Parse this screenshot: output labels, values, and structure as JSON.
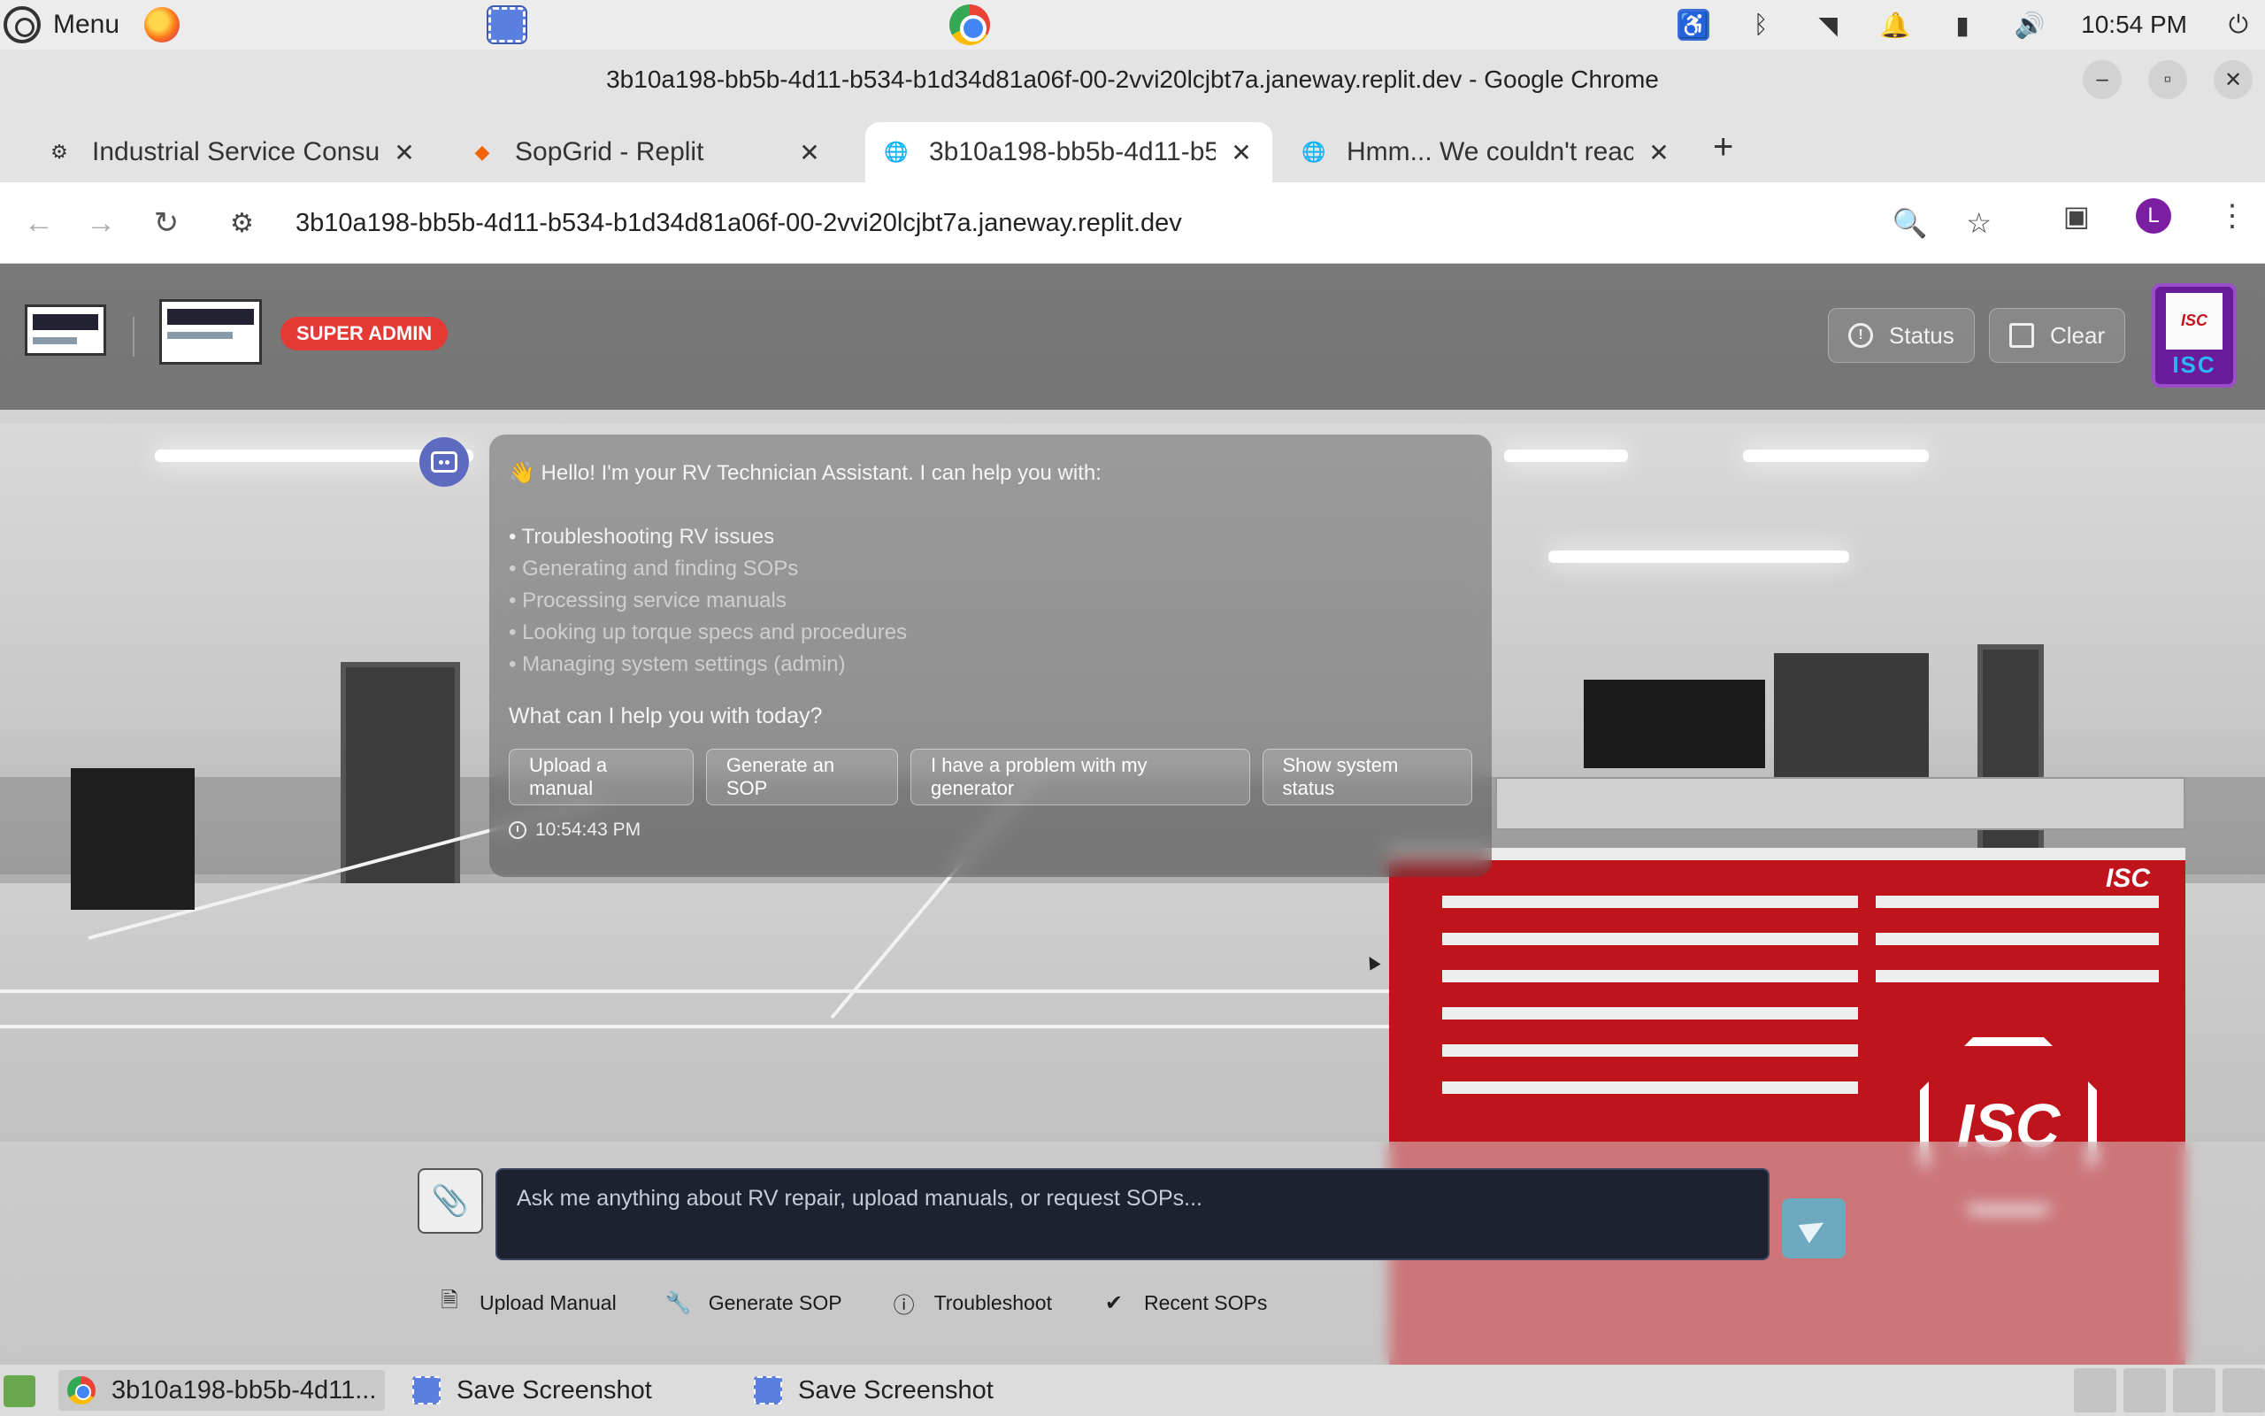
{
  "os": {
    "menu_label": "Menu",
    "clock": "10:54 PM"
  },
  "window": {
    "title": "3b10a198-bb5b-4d11-b534-b1d34d81a06f-00-2vvi20lcjbt7a.janeway.replit.dev - Google Chrome"
  },
  "tabs": [
    {
      "label": "Industrial Service Consul",
      "icon": "openai-icon"
    },
    {
      "label": "SopGrid - Replit",
      "icon": "replit-icon"
    },
    {
      "label": "3b10a198-bb5b-4d11-b5",
      "icon": "globe-icon"
    },
    {
      "label": "Hmm... We couldn't reac",
      "icon": "globe-icon"
    }
  ],
  "address_bar": {
    "url": "3b10a198-bb5b-4d11-b534-b1d34d81a06f-00-2vvi20lcjbt7a.janeway.replit.dev",
    "profile_initial": "L"
  },
  "app": {
    "role_badge": "SUPER ADMIN",
    "status_label": "Status",
    "clear_label": "Clear",
    "logo_text": "ISC",
    "logo_small": "ISC"
  },
  "message": {
    "greeting": "👋 Hello! I'm your RV Technician Assistant. I can help you with:",
    "items": [
      "• Troubleshooting RV issues",
      "• Generating and finding SOPs",
      "• Processing service manuals",
      "• Looking up torque specs and procedures",
      "• Managing system settings (admin)"
    ],
    "question": "What can I help you with today?",
    "suggestions": [
      "Upload a manual",
      "Generate an SOP",
      "I have a problem with my generator",
      "Show system status"
    ],
    "timestamp": "10:54:43 PM"
  },
  "background": {
    "toolbox_brand": "ISC",
    "toolbox_emblem": "ISC"
  },
  "composer": {
    "placeholder": "Ask me anything about RV repair, upload manuals, or request SOPs..."
  },
  "quick_actions": [
    {
      "label": "Upload Manual",
      "icon": "file-icon"
    },
    {
      "label": "Generate SOP",
      "icon": "wrench-icon"
    },
    {
      "label": "Troubleshoot",
      "icon": "alert-circle-icon"
    },
    {
      "label": "Recent SOPs",
      "icon": "check-circle-icon"
    }
  ],
  "taskbar": {
    "items": [
      "3b10a198-bb5b-4d11...",
      "Save Screenshot",
      "Save Screenshot"
    ]
  },
  "colors": {
    "badge": "#e53935",
    "accent_purple": "#6a1b9a",
    "toolbox_red": "#c0141c",
    "send_button": "#6fa9c0"
  }
}
